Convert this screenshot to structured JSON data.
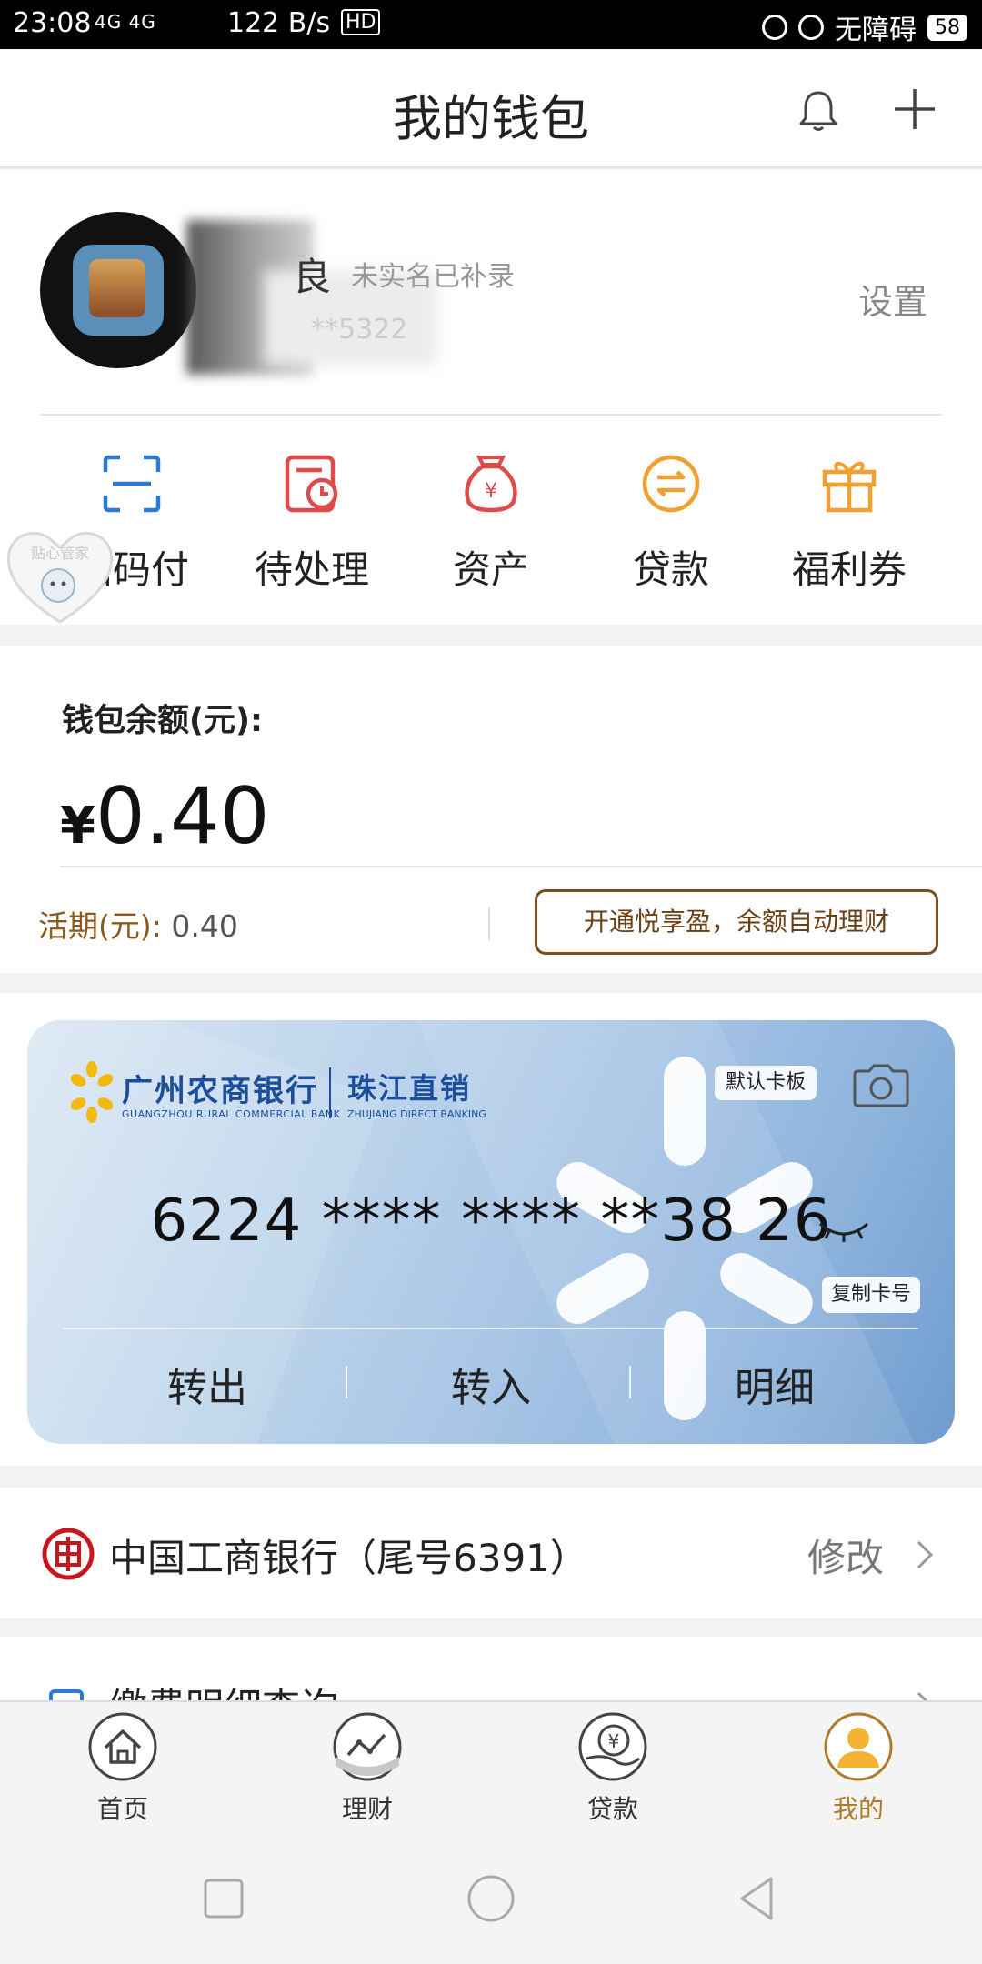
{
  "status_bar": {
    "time": "23:08",
    "signal": "4G 4G",
    "speed": "122 B/s",
    "hd": "HD",
    "accessibility": "无障碍",
    "battery": "58"
  },
  "header": {
    "title": "我的钱包",
    "bell_icon": "bell-icon",
    "add_icon": "plus-icon"
  },
  "profile": {
    "name_visible": "良",
    "verify_status": "未实名已补录",
    "phone_tail": "**5322",
    "settings_label": "设置"
  },
  "quick_actions": [
    {
      "label": "扫码付",
      "icon": "scan-icon",
      "color": "#2b7ad6"
    },
    {
      "label": "待处理",
      "icon": "pending-icon",
      "color": "#e04a4a"
    },
    {
      "label": "资产",
      "icon": "money-bag-icon",
      "color": "#e04a4a"
    },
    {
      "label": "贷款",
      "icon": "exchange-icon",
      "color": "#f0a030"
    },
    {
      "label": "福利券",
      "icon": "gift-icon",
      "color": "#f0a030"
    }
  ],
  "floating_widget": {
    "label": "贴心管家"
  },
  "balance": {
    "label": "钱包余额(元):",
    "currency": "¥",
    "amount": "0.40",
    "current_label": "活期(元):",
    "current_value": "0.40",
    "promo_button": "开通悦享盈，余额自动理财"
  },
  "card": {
    "bank_name": "广州农商银行",
    "bank_name_en": "GUANGZHOU RURAL COMMERCIAL BANK",
    "direct_name": "珠江直销",
    "direct_name_en": "ZHUJIANG DIRECT BANKING",
    "default_badge": "默认卡板",
    "number": "6224 **** **** **38 26",
    "copy_button": "复制卡号",
    "actions": [
      "转出",
      "转入",
      "明细"
    ]
  },
  "linked_bank": {
    "name": "中国工商银行（尾号6391）",
    "action": "修改"
  },
  "next_row": {
    "label": "缴费明细查询"
  },
  "tabs": [
    {
      "label": "首页",
      "icon": "home-icon",
      "active": false
    },
    {
      "label": "理财",
      "icon": "chart-icon",
      "active": false
    },
    {
      "label": "贷款",
      "icon": "loan-icon",
      "active": false
    },
    {
      "label": "我的",
      "icon": "user-icon",
      "active": true
    }
  ],
  "colors": {
    "accent_gold": "#b07a2a",
    "promo_border": "#7a4e1f",
    "card_blue": "#1b4f9e"
  }
}
